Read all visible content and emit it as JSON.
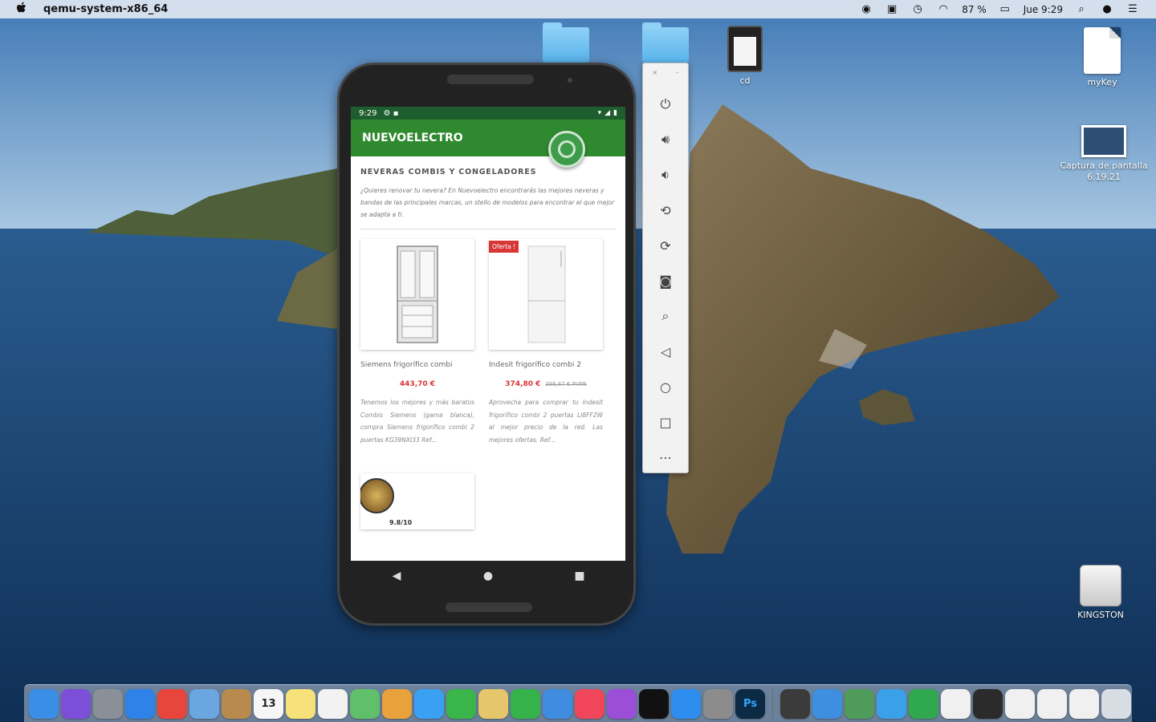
{
  "menubar": {
    "app_name": "qemu-system-x86_64",
    "battery": "87 %",
    "clock": "Jue 9:29"
  },
  "desktop": {
    "items": [
      {
        "label": ""
      },
      {
        "label": ""
      },
      {
        "label": "cd"
      },
      {
        "label": "myKey"
      },
      {
        "label": "Captura de pantalla 6.19.21"
      },
      {
        "label": "KINGSTON"
      }
    ]
  },
  "phone": {
    "status_time": "9:29",
    "app_title": "NUEVOELECTRO",
    "section_title": "NEVERAS COMBIS Y CONGELADORES",
    "intro": "¿Quieres renovar tu nevera? En Nuevoelectro encontrarás las mejores neveras y bandas de las principales marcas, un stello de modelos para encontrar el que mejor se adapta a ti.",
    "products": [
      {
        "name": "Siemens frigorífico combi",
        "price": "443,70 €",
        "old_price": "",
        "badge": "",
        "desc": "Tenemos los mejores y más baratos Combis Siemens (gama blanca), compra Siemens frigorífico combi 2 puertas KG39NXI33 Ref..."
      },
      {
        "name": "Indesit frigorífico combi 2",
        "price": "374,80 €",
        "old_price": "398,67 € PVPR",
        "badge": "Oferta !",
        "desc": "Aprovecha para comprar tu Indesit frigorífico combi 2 puertas LI8FF2W al mejor precio de la red. Las mejores ofertas. Ref..."
      }
    ],
    "third_rating": "9.8/10"
  },
  "colors": {
    "app_green": "#2f8a2f",
    "status_green": "#1e5e2e",
    "price_red": "#d93636"
  },
  "dock": {
    "apps": [
      {
        "name": "finder",
        "color": "#3a8ee6"
      },
      {
        "name": "siri",
        "color": "#7d4fd8"
      },
      {
        "name": "launchpad",
        "color": "#8a8f98"
      },
      {
        "name": "safari",
        "color": "#2f82e8"
      },
      {
        "name": "chrome",
        "color": "#e8453c"
      },
      {
        "name": "preview",
        "color": "#6aa7e0"
      },
      {
        "name": "notebook",
        "color": "#b98a4e"
      },
      {
        "name": "calendar",
        "color": "#f6f6f6"
      },
      {
        "name": "notes",
        "color": "#f7e27a"
      },
      {
        "name": "reminders",
        "color": "#f2f2f2"
      },
      {
        "name": "maps",
        "color": "#5fbf6a"
      },
      {
        "name": "photos",
        "color": "#e9a13b"
      },
      {
        "name": "messages-blue",
        "color": "#3aa0f2"
      },
      {
        "name": "facetime",
        "color": "#39b54a"
      },
      {
        "name": "textedit",
        "color": "#e6c66a"
      },
      {
        "name": "numbers",
        "color": "#35b24a"
      },
      {
        "name": "keynote",
        "color": "#3f8ce0"
      },
      {
        "name": "music",
        "color": "#f0455b"
      },
      {
        "name": "podcasts",
        "color": "#9b4fd8"
      },
      {
        "name": "apple-tv",
        "color": "#111111"
      },
      {
        "name": "app-store",
        "color": "#2d8ef0"
      },
      {
        "name": "system-preferences",
        "color": "#8c8c8c"
      },
      {
        "name": "photoshop",
        "color": "#0d2a44"
      },
      {
        "name": "sublime",
        "color": "#3b3b3b"
      },
      {
        "name": "xcode",
        "color": "#3f8fe0"
      },
      {
        "name": "android-studio",
        "color": "#4f9b5a"
      },
      {
        "name": "migration",
        "color": "#3aa0e8"
      },
      {
        "name": "sheets",
        "color": "#2fa84f"
      },
      {
        "name": "file-1",
        "color": "#f0f0f0"
      },
      {
        "name": "terminal",
        "color": "#2b2b2b"
      },
      {
        "name": "file-2",
        "color": "#f0f0f0"
      },
      {
        "name": "file-3",
        "color": "#f0f0f0"
      },
      {
        "name": "file-4",
        "color": "#f0f0f0"
      },
      {
        "name": "trash",
        "color": "#d8dde4"
      }
    ],
    "labels": {
      "photoshop": "Ps",
      "calendar_day": "13"
    }
  }
}
